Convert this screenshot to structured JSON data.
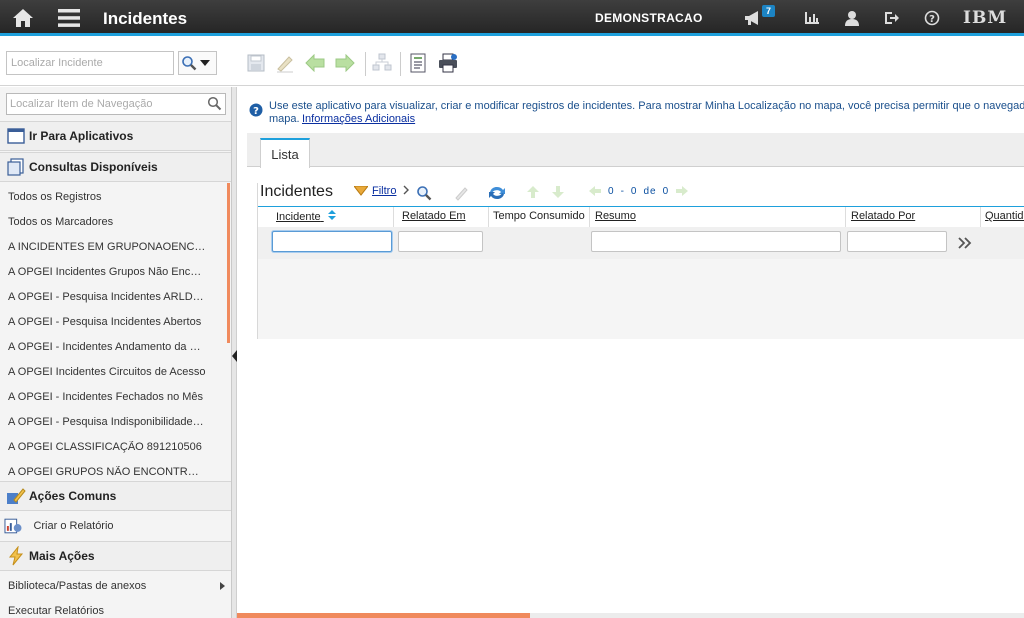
{
  "header": {
    "app_title": "Incidentes",
    "site_name": "DEMONSTRACAO",
    "notification_count": "7",
    "logo_text": "IBM"
  },
  "toolbar": {
    "search_placeholder": "Localizar Incidente"
  },
  "nav": {
    "search_placeholder": "Localizar Item de Navegação",
    "go_to_apps": "Ir Para Aplicativos",
    "queries_header": "Consultas Disponíveis",
    "queries": [
      "Todos os Registros",
      "Todos os Marcadores",
      "A INCIDENTES EM GRUPONAOENCONTRADO",
      "A OPGEI Incidentes Grupos Não Encontrados",
      "A OPGEI - Pesquisa Incidentes ARLD Abertos",
      "A OPGEI - Pesquisa Incidentes Abertos",
      "A OPGEI - Incidentes Andamento da Semana",
      "A OPGEI Incidentes Circuitos de Acesso",
      "A OPGEI - Incidentes Fechados no Mês",
      "A OPGEI - Pesquisa Indisponibilidade de Serviço",
      "A OPGEI CLASSIFICAÇÃO 891210506",
      "A OPGEI GRUPOS NÃO ENCONTRADOS"
    ],
    "common_actions_header": "Ações Comuns",
    "create_report": "Criar o Relatório",
    "more_actions_header": "Mais Ações",
    "more_actions": [
      "Biblioteca/Pastas de anexos",
      "Executar Relatórios"
    ]
  },
  "main": {
    "info_text": "Use este aplicativo para visualizar, criar e modificar registros de incidentes. Para mostrar Minha Localização no mapa, você precisa permitir que o navegador acesse sua localização no",
    "info_text_line2": "mapa.",
    "info_link": "Informações Adicionais",
    "tab_label": "Lista",
    "list_title": "Incidentes",
    "filter_label": "Filtro",
    "pager": {
      "from": "0",
      "sep": "-",
      "to": "0",
      "of_label": "de",
      "total": "0"
    },
    "columns": [
      "Incidente",
      "Relatado Em",
      "Tempo Consumido",
      "Resumo",
      "Relatado Por",
      "Quantidade"
    ]
  },
  "colors": {
    "accent": "#1ea0dc",
    "scroll_thumb": "#f08a5d",
    "header_bg": "#2f2f2f"
  }
}
